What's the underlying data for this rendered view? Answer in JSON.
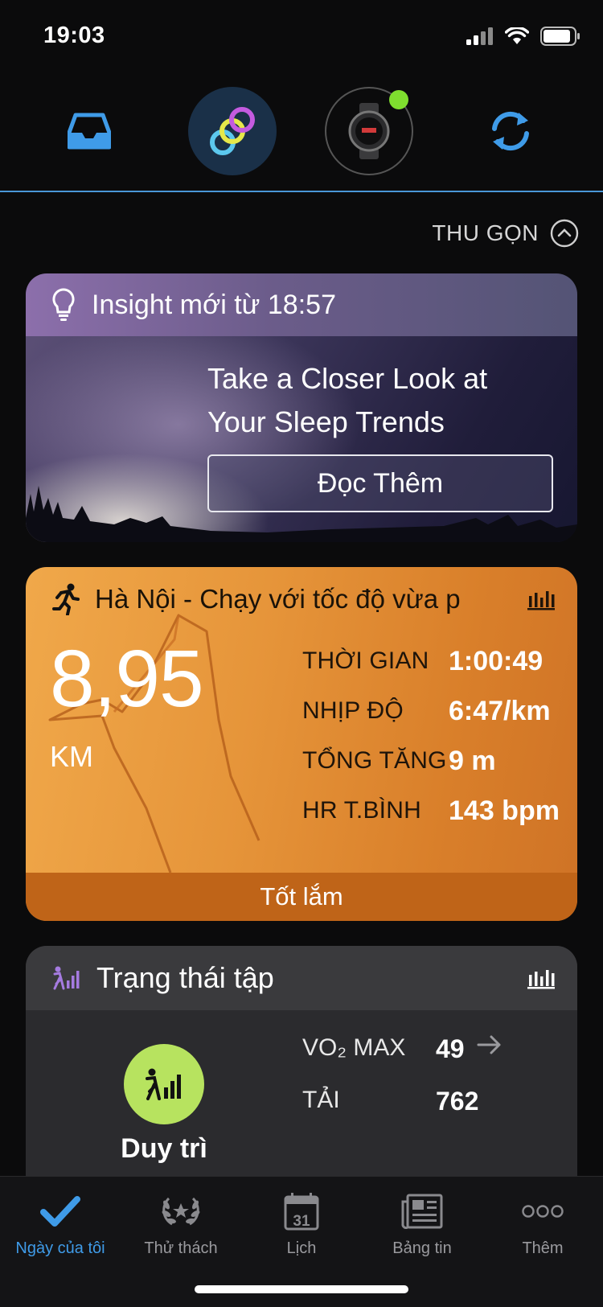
{
  "status_bar": {
    "time": "19:03"
  },
  "header": {
    "collapse_label": "THU GỌN"
  },
  "insight": {
    "title": "Insight mới từ 18:57",
    "headline": "Take a Closer Look at Your Sleep Trends",
    "button_label": "Đọc Thêm"
  },
  "run": {
    "title": "Hà Nội - Chạy với tốc độ vừa p",
    "distance": "8,95",
    "unit": "KM",
    "stats": [
      {
        "label": "THỜI GIAN",
        "value": "1:00:49"
      },
      {
        "label": "NHỊP ĐỘ",
        "value": "6:47/km"
      },
      {
        "label": "TỔNG TĂNG",
        "value": "9 m"
      },
      {
        "label": "HR T.BÌNH",
        "value": "143 bpm"
      }
    ],
    "footer": "Tốt lắm",
    "accent": "#e6953a"
  },
  "training": {
    "title": "Trạng thái tập",
    "state": "Duy trì",
    "vo2_label": "VO₂ MAX",
    "vo2_value": "49",
    "load_label": "TẢI",
    "load_value": "762",
    "state_color": "#b7e35f"
  },
  "nav": [
    {
      "label": "Ngày của tôi",
      "icon": "checkmark-icon",
      "active": true
    },
    {
      "label": "Thử thách",
      "icon": "laurel-icon",
      "active": false
    },
    {
      "label": "Lịch",
      "icon": "calendar-icon",
      "calendar_day": "31",
      "active": false
    },
    {
      "label": "Bảng tin",
      "icon": "newsfeed-icon",
      "active": false
    },
    {
      "label": "Thêm",
      "icon": "more-icon",
      "active": false
    }
  ],
  "colors": {
    "accent_blue": "#3f9be8",
    "watch_online": "#7fdf2f"
  }
}
